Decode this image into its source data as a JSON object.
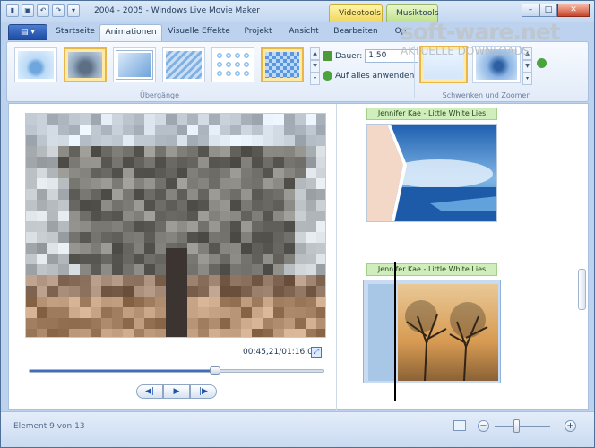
{
  "window": {
    "title": "2004 - 2005 - Windows Live Movie Maker",
    "context_tabs": [
      "Videotools",
      "Musiktools"
    ],
    "buttons": {
      "minimize": "–",
      "maximize": "□",
      "close": "✕"
    }
  },
  "quick_access": [
    "▮",
    "▣",
    "↶",
    "↷",
    "▾"
  ],
  "app_menu": {
    "label": "▤ ▾"
  },
  "tabs": [
    "Startseite",
    "Animationen",
    "Visuelle Effekte",
    "Projekt",
    "Ansicht",
    "Bearbeiten",
    "Op"
  ],
  "active_tab": "Animationen",
  "ribbon": {
    "transitions_group_label": "Übergänge",
    "duration_label": "Dauer:",
    "duration_value": "1,50",
    "apply_all_label": "Auf alles anwenden",
    "pan_group_label": "Schwenken und Zoomen",
    "gallery_scroll": [
      "▲",
      "▼",
      "▾"
    ]
  },
  "watermark": {
    "line1": "soft-ware.net",
    "line2": "AKTUELLE DOWNLOADS"
  },
  "player": {
    "time": "00:45,21/01:16,00",
    "fullscreen_icon": "⤢",
    "progress": 0.63,
    "buttons": {
      "prev": "◀|",
      "play": "▶",
      "next": "|▶"
    }
  },
  "storyboard": {
    "tracks": [
      {
        "title": "Jennifer Kae - Little White Lies"
      },
      {
        "title": "Jennifer Kae - Little White Lies"
      }
    ]
  },
  "status": {
    "text": "Element 9 von 13",
    "zoom_minus": "−",
    "zoom_plus": "+",
    "zoom_level": 0.4
  },
  "colors": {
    "accent": "#3d6fbf",
    "video_tab": "#f1d65a",
    "music_tab": "#bfe08a",
    "selection": "#e8b74a",
    "music_track": "#cfeebb"
  }
}
